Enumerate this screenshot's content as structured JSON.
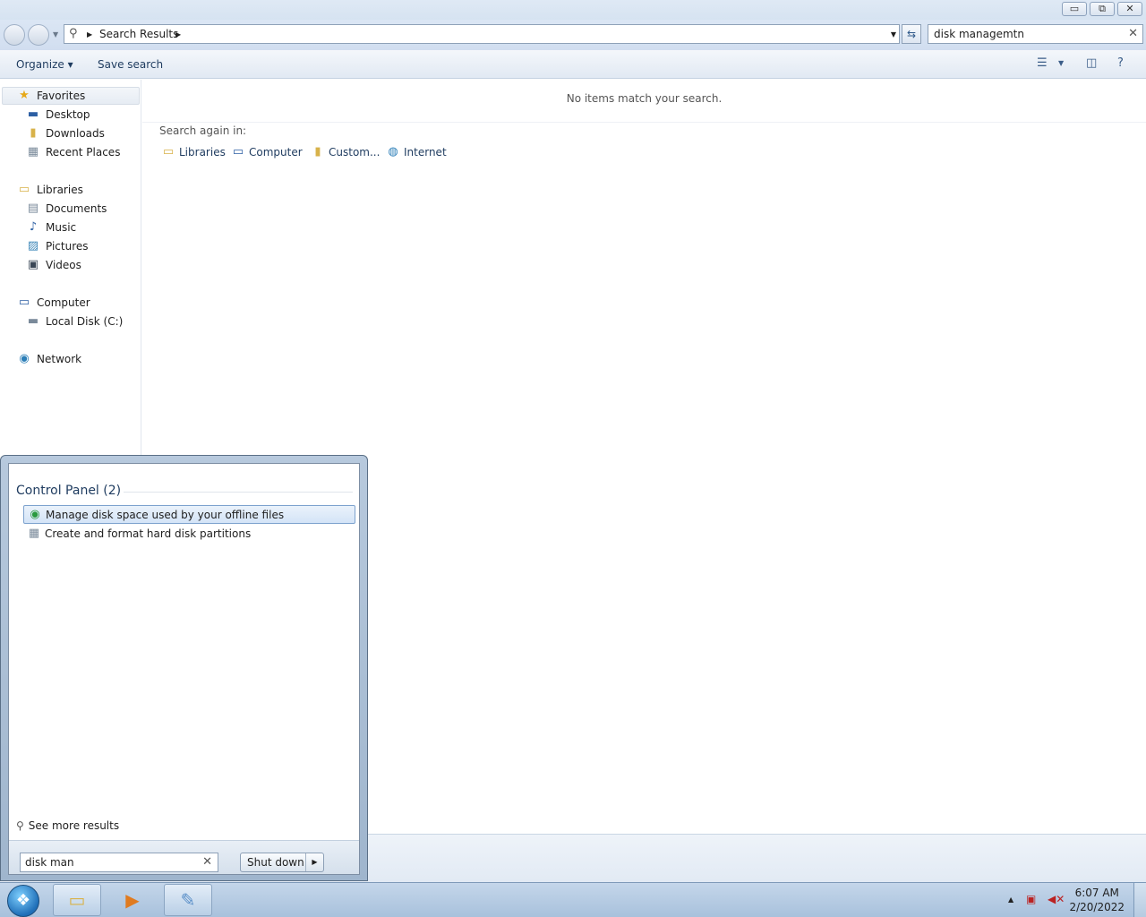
{
  "window": {
    "controls": {
      "minimize": "▭",
      "maximize": "⧉",
      "close": "✕"
    }
  },
  "address": {
    "crumb": "Search Results",
    "search_value": "disk managemtn"
  },
  "toolbar": {
    "organize": "Organize ▾",
    "save_search": "Save search"
  },
  "navpane": {
    "favorites": {
      "label": "Favorites",
      "items": [
        "Desktop",
        "Downloads",
        "Recent Places"
      ]
    },
    "libraries": {
      "label": "Libraries",
      "items": [
        "Documents",
        "Music",
        "Pictures",
        "Videos"
      ]
    },
    "computer": {
      "label": "Computer",
      "items": [
        "Local Disk (C:)"
      ]
    },
    "network": {
      "label": "Network"
    }
  },
  "content": {
    "no_items": "No items match your search.",
    "search_again_label": "Search again in:",
    "search_again_links": [
      "Libraries",
      "Computer",
      "Custom...",
      "Internet"
    ]
  },
  "startmenu": {
    "group_header": "Control Panel (2)",
    "results": [
      "Manage disk space used by your offline files",
      "Create and format hard disk partitions"
    ],
    "see_more": "See more results",
    "search_value": "disk man",
    "shutdown": "Shut down"
  },
  "taskbar": {
    "time": "6:07 AM",
    "date": "2/20/2022"
  },
  "colors": {
    "accent": "#1e3b5f",
    "selection": "#d4e4f7",
    "taskbar": "#b3c9e2"
  }
}
